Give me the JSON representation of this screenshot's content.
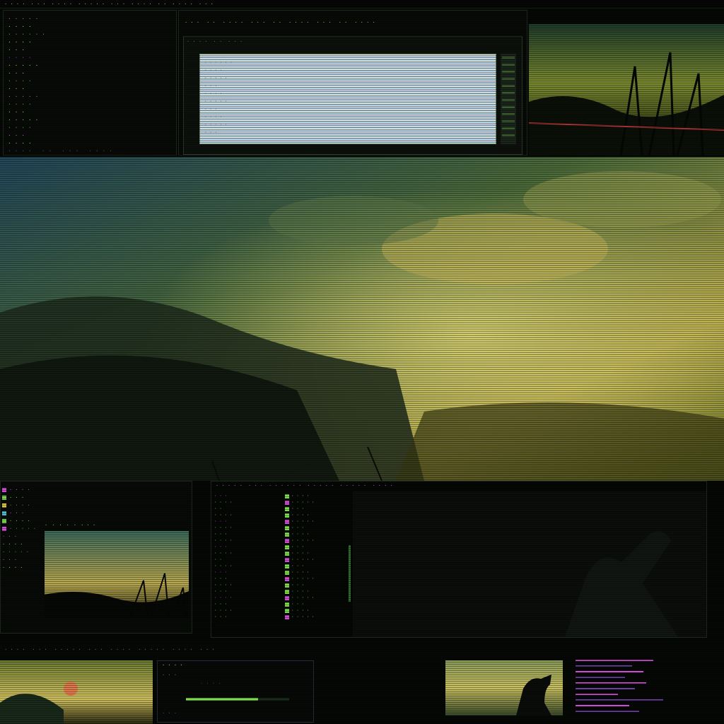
{
  "topbar": {
    "items": [
      "· · · ·",
      "· · ·",
      "· · · ·",
      "· · · · ·",
      "· · ·",
      "· · · ·",
      "· ·",
      "· · · ·",
      "· · ·"
    ]
  },
  "terminal": {
    "lines": [
      "· · · · ·",
      "· · · ·",
      "· · · · · ·",
      "· · · ·",
      "· · ·",
      "· · · ·",
      "· · · · ·",
      "· · ·",
      "· · · ·",
      "· · ·",
      "· · · · ·",
      "· · · ·",
      "· · ·",
      "· · · · ·",
      "· · · ·",
      "· · ·",
      "· · · ·"
    ],
    "footer": [
      "· · · ·",
      "· ·",
      "· · ·",
      "· · · ·"
    ]
  },
  "main_window": {
    "menu": [
      "· · ·",
      "· ·",
      "· · · ·",
      "· · ·",
      "· ·",
      "· · · ·",
      "· · ·",
      "· ·",
      "· · · ·"
    ],
    "tabs": [
      "· · · ·",
      "· ·",
      "· · ·"
    ],
    "doc_rows": [
      "· · · · · ·",
      "· · · ·",
      "· · · · ·",
      "· · ·",
      "· · · ·",
      "· · · · ·",
      "· · ·",
      "· · · ·",
      "· · · · ·",
      "· · ·"
    ]
  },
  "top_right_tabs": [
    "· · · ·",
    "· · · ·",
    "· · ·"
  ],
  "file_manager": {
    "sidebar": [
      "· · · ·",
      "· · ·",
      "· · · ·",
      "· · ·",
      "· · · ·",
      "· · · · ·",
      "· · ·",
      "· · · ·",
      "· · · · ·",
      "· · ·",
      "· · · ·"
    ],
    "toolbar": [
      "·",
      "·",
      "·",
      "·",
      "·",
      "· · ·"
    ],
    "title": "· · · ·"
  },
  "editor": {
    "header": [
      "· · · · ·",
      "· · ·",
      "· · · · · ·",
      "· · · · ·",
      "· · · · ·",
      "· · · ·"
    ],
    "left_rows": [
      "· · ·",
      "· · · ·",
      "· ·",
      "· · · ·",
      "· · ·",
      "· · · ·",
      "· · ·",
      "· · · ·",
      "· · ·",
      "· · · ·",
      "· ·",
      "· · · ·",
      "· · ·",
      "· · ·",
      "· · · ·",
      "· · ·",
      "· · · ·",
      "· · ·",
      "· · · ·",
      "· · ·"
    ],
    "list_rows": [
      "· · · ·",
      "· · · · ·",
      "· · ·",
      "· · · ·",
      "· · · · ·",
      "· · ·",
      "· · · ·",
      "· · · · ·",
      "· · ·",
      "· · · ·",
      "· · · · ·",
      "· · ·",
      "· · · ·",
      "· · · · ·",
      "· · ·",
      "· · · ·",
      "· · · · ·",
      "· · ·",
      "· · · ·",
      "· · · · ·"
    ]
  },
  "taskbar": {
    "items": [
      "· · · ·",
      "· · ·",
      "· · · · ·",
      "· · ·",
      "· · · ·",
      "· · · · ·",
      "· · · ·",
      "· · ·"
    ]
  },
  "media": {
    "title": "· · · ·",
    "line1": "· · ·",
    "line2": "· · · ·",
    "buttons": "· · ·",
    "progress": 0.7
  },
  "br_panel": {
    "rows": [
      0.55,
      0.4,
      0.48,
      0.35,
      0.5,
      0.42,
      0.3,
      0.62,
      0.38,
      0.45
    ]
  },
  "colors": {
    "accent_green": "#7ddc4a",
    "accent_magenta": "#d24bd6",
    "accent_purple": "#6b3fa8"
  }
}
